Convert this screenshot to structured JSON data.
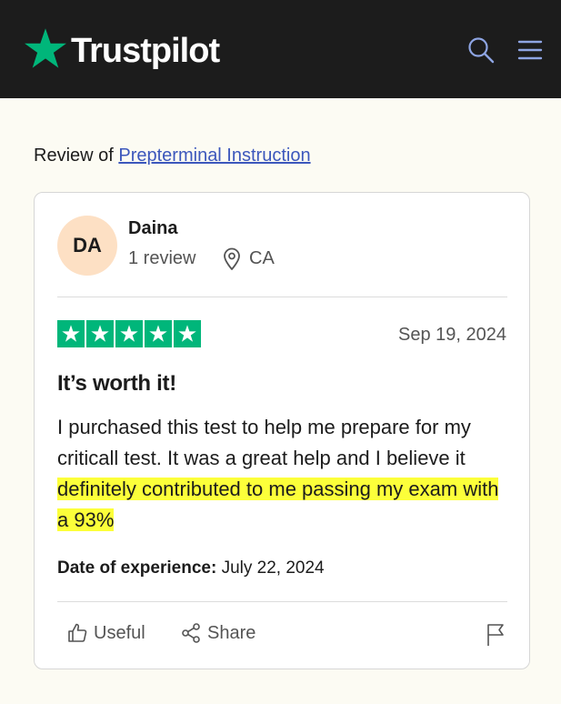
{
  "header": {
    "logo_text": "Trustpilot",
    "logo_icon": "star-icon",
    "search_icon": "search-icon",
    "menu_icon": "hamburger-menu-icon",
    "background_color": "#1c1c1c",
    "brand_color": "#00b67a"
  },
  "review_of": {
    "prefix": "Review of",
    "company": "Prepterminal Instruction"
  },
  "review": {
    "avatar_initials": "DA",
    "avatar_color": "#fde0c4",
    "reviewer_name": "Daina",
    "review_count": "1 review",
    "location": "CA",
    "rating": 5,
    "rating_max": 5,
    "date": "Sep 19, 2024",
    "title": "It’s worth it!",
    "body_plain": "I purchased this test to help me prepare for my criticall test. It was a great help and I believe it ",
    "body_highlighted": "definitely contributed to me passing my exam with a 93%",
    "highlight_color": "#fcff3a",
    "date_of_experience_label": "Date of experience:",
    "date_of_experience_value": "July 22, 2024"
  },
  "actions": {
    "useful_label": "Useful",
    "share_label": "Share",
    "useful_icon": "thumbs-up-icon",
    "share_icon": "share-icon",
    "flag_icon": "flag-icon"
  }
}
